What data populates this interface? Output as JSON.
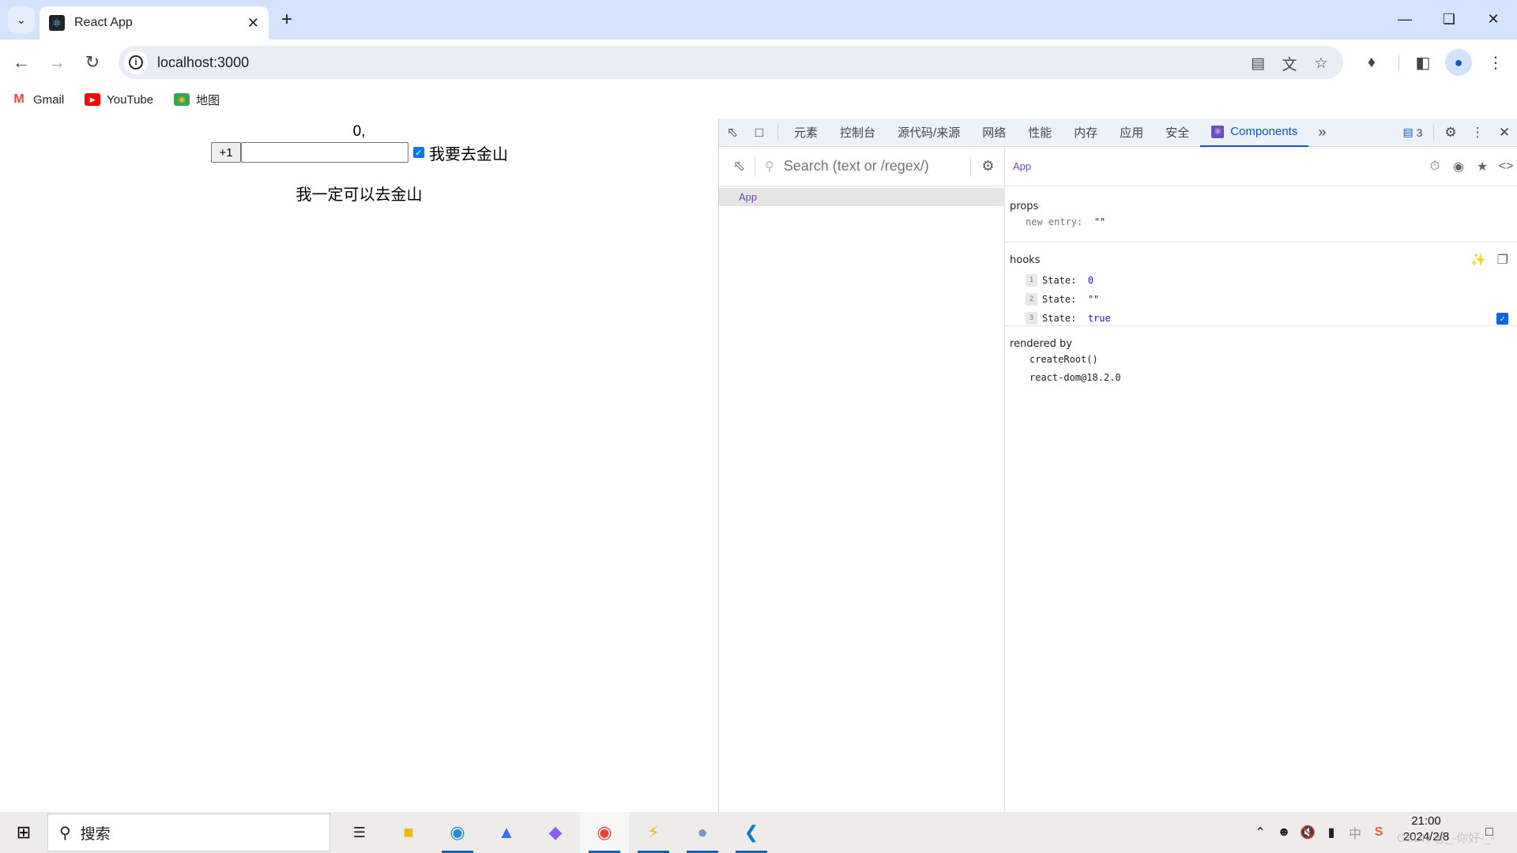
{
  "browser": {
    "tab_title": "React App",
    "url": "localhost:3000",
    "bookmarks": [
      {
        "label": "Gmail",
        "icon": "gmail-icon"
      },
      {
        "label": "YouTube",
        "icon": "youtube-icon"
      },
      {
        "label": "地图",
        "icon": "maps-icon"
      }
    ]
  },
  "page": {
    "count_text": "0,",
    "increment_label": "+1",
    "entry_value": "",
    "checkbox_checked": true,
    "checkbox_label": "我要去金山",
    "message": "我一定可以去金山"
  },
  "devtools": {
    "tabs": [
      "元素",
      "控制台",
      "源代码/来源",
      "网络",
      "性能",
      "内存",
      "应用",
      "安全",
      "Components"
    ],
    "active_tab": "Components",
    "issues_count": "3",
    "search_placeholder": "Search (text or /regex/)",
    "tree": [
      {
        "label": "App",
        "selected": true
      }
    ],
    "selected_component": "App",
    "props": {
      "title": "props",
      "items": [
        {
          "key": "new entry",
          "value": "\"\""
        }
      ]
    },
    "hooks": {
      "title": "hooks",
      "items": [
        {
          "index": "1",
          "key": "State",
          "value": "0"
        },
        {
          "index": "2",
          "key": "State",
          "value": "\"\""
        },
        {
          "index": "3",
          "key": "State",
          "value": "true",
          "checkbox": true
        }
      ]
    },
    "rendered_by": {
      "title": "rendered by",
      "items": [
        "createRoot()",
        "react-dom@18.2.0"
      ]
    }
  },
  "taskbar": {
    "search_label": "搜索",
    "time": "21:00",
    "date": "2024/2/8",
    "watermark": "CSDN @_-你好-_-",
    "ime": "中"
  }
}
